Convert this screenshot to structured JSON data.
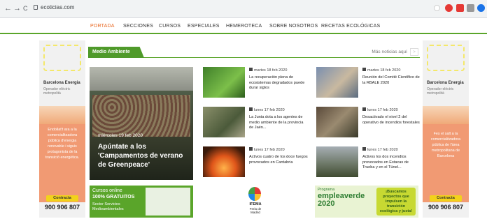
{
  "browser": {
    "url": "ecoticias.com",
    "back": "←",
    "forward": "→",
    "reload": "C"
  },
  "menu": {
    "items": [
      "PORTADA",
      "SECCIONES",
      "CURSOS",
      "ESPECIALES",
      "HEMEROTECA",
      "SOBRE NOSOTROS",
      "RECETAS ECOLÓGICAS"
    ]
  },
  "section": {
    "title": "Medio Ambiente",
    "more": "Más noticias aquí",
    "more_arrow": ">"
  },
  "feature": {
    "date": "miércoles 19 feb 2020",
    "title": "Apúntate a los 'Campamentos de verano de Greenpeace'"
  },
  "news": [
    {
      "date": "martes 18 feb 2020",
      "headline": "La recuperación plena de ecosistemas degradados puede durar siglos"
    },
    {
      "date": "martes 18 feb 2020",
      "headline": "Reunión del Comité Científico de la RBALE 2020"
    },
    {
      "date": "lunes 17 feb 2020",
      "headline": "La Junta dota a los agentes de medio ambiente de la provincia de Jaén..."
    },
    {
      "date": "lunes 17 feb 2020",
      "headline": "Desactivado el nivel 2 del operativo de incendios forestales"
    },
    {
      "date": "lunes 17 feb 2020",
      "headline": "Activos cuatro de los doce fuegos provocados en Cantabria"
    },
    {
      "date": "lunes 17 feb 2020",
      "headline": "Activos los dos incendios provocados en Estacas de Trueba y en el Túnel..."
    }
  ],
  "side_ad": {
    "brand": "Barcelona Energia",
    "sub": "Operador eléctric metropolità",
    "button": "Contracta",
    "phone": "900 906 807",
    "promo_left": "Endollat't ara a la comercialitzadora pública d'energia renovable i siguis protagonista de la transició energètica.",
    "promo_right": "Fes el salt a la comercialitzadora pública de l'àrea metropolitana de Barcelona"
  },
  "bottom_ads": {
    "cursos_line1": "Cursos online",
    "cursos_line2": "100% GRATUITOS",
    "cursos_line3": "Sector Servicios Medioambientales",
    "ifema": "IFEMA",
    "ifema_sub": "Feria de Madrid",
    "empleaverde_label": "Programa",
    "empleaverde_title": "empleaverde 2020",
    "empleaverde_slogan": "¡Buscamos proyectos que impulsen la transición ecológica y justa!"
  },
  "colors": {
    "accent_green": "#5aa52a",
    "menu_active": "#e8661f",
    "promo_salmon": "#f19a73",
    "ad_yellow": "#f2d21b"
  }
}
